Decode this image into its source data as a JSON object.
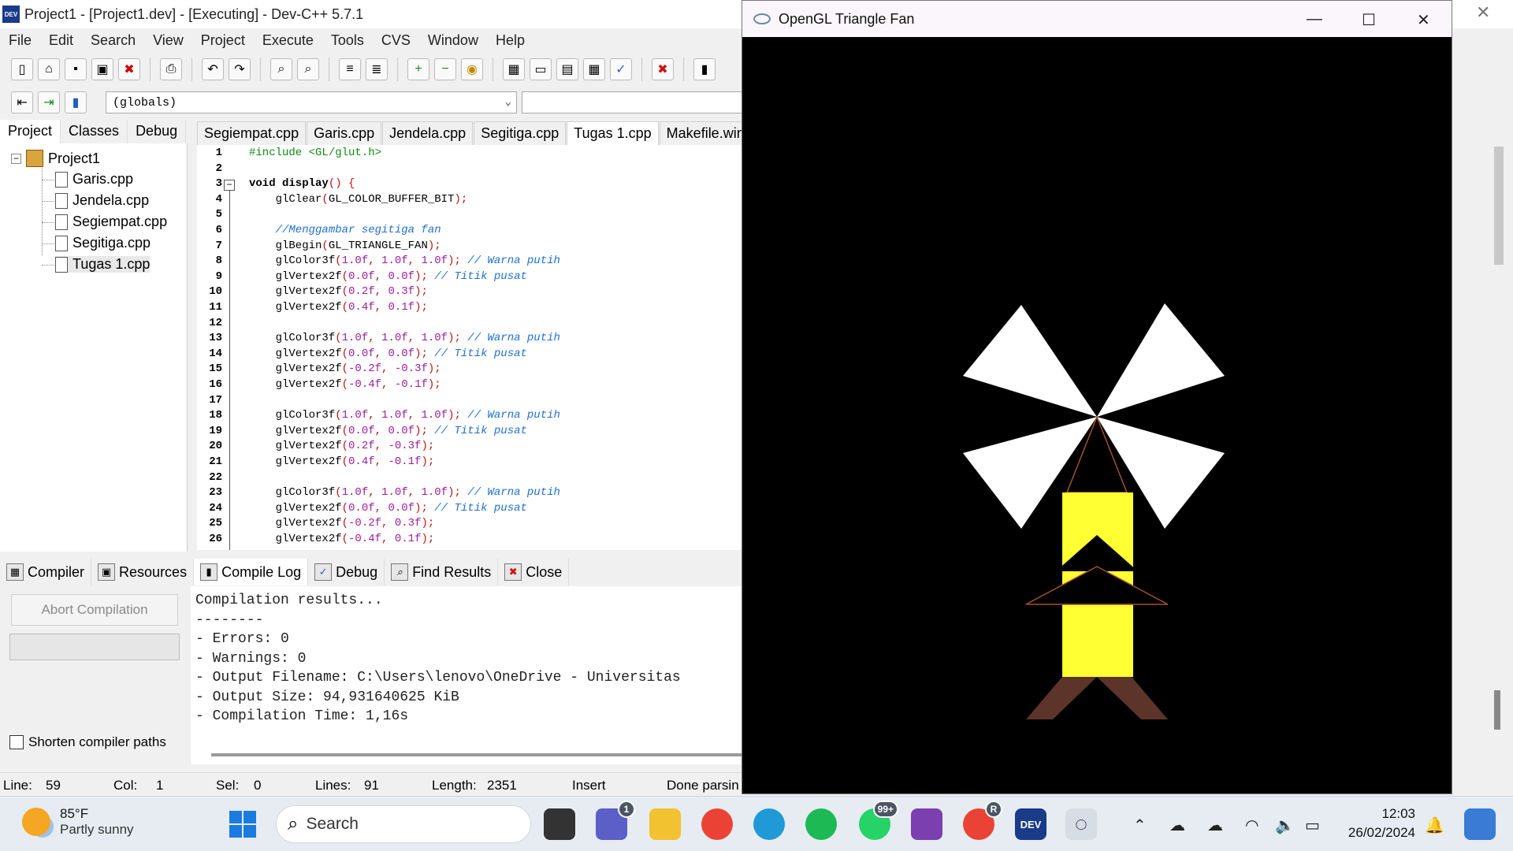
{
  "ide": {
    "title": "Project1 - [Project1.dev] - [Executing] - Dev-C++ 5.7.1",
    "app_icon_text": "DEV",
    "menu": [
      "File",
      "Edit",
      "Search",
      "View",
      "Project",
      "Execute",
      "Tools",
      "CVS",
      "Window",
      "Help"
    ],
    "scope_select": "(globals)",
    "left_tabs": [
      "Project",
      "Classes",
      "Debug"
    ],
    "tree": {
      "root": "Project1",
      "files": [
        "Garis.cpp",
        "Jendela.cpp",
        "Segiempat.cpp",
        "Segitiga.cpp",
        "Tugas 1.cpp"
      ]
    },
    "editor_tabs": [
      "Segiempat.cpp",
      "Garis.cpp",
      "Jendela.cpp",
      "Segitiga.cpp",
      "Tugas 1.cpp",
      "Makefile.win"
    ],
    "code_lines": [
      {
        "n": "1",
        "parts": [
          {
            "t": "#include <GL/glut.h>",
            "c": "pp"
          }
        ]
      },
      {
        "n": "2",
        "parts": []
      },
      {
        "n": "3",
        "parts": [
          {
            "t": "void display",
            "c": "kw"
          },
          {
            "t": "() {",
            "c": "pn"
          }
        ]
      },
      {
        "n": "4",
        "parts": [
          {
            "t": "    glClear",
            "c": ""
          },
          {
            "t": "(",
            "c": "pn"
          },
          {
            "t": "GL_COLOR_BUFFER_BIT",
            "c": ""
          },
          {
            "t": ");",
            "c": "pn"
          }
        ]
      },
      {
        "n": "5",
        "parts": []
      },
      {
        "n": "6",
        "parts": [
          {
            "t": "    //Menggambar segitiga fan",
            "c": "cm"
          }
        ]
      },
      {
        "n": "7",
        "parts": [
          {
            "t": "    glBegin",
            "c": ""
          },
          {
            "t": "(",
            "c": "pn"
          },
          {
            "t": "GL_TRIANGLE_FAN",
            "c": ""
          },
          {
            "t": ");",
            "c": "pn"
          }
        ]
      },
      {
        "n": "8",
        "parts": [
          {
            "t": "    glColor3f",
            "c": ""
          },
          {
            "t": "(",
            "c": "pn"
          },
          {
            "t": "1.0f",
            "c": "num"
          },
          {
            "t": ", ",
            "c": "pn"
          },
          {
            "t": "1.0f",
            "c": "num"
          },
          {
            "t": ", ",
            "c": "pn"
          },
          {
            "t": "1.0f",
            "c": "num"
          },
          {
            "t": "); ",
            "c": "pn"
          },
          {
            "t": "// Warna putih",
            "c": "cm"
          }
        ]
      },
      {
        "n": "9",
        "parts": [
          {
            "t": "    glVertex2f",
            "c": ""
          },
          {
            "t": "(",
            "c": "pn"
          },
          {
            "t": "0.0f",
            "c": "num"
          },
          {
            "t": ", ",
            "c": "pn"
          },
          {
            "t": "0.0f",
            "c": "num"
          },
          {
            "t": "); ",
            "c": "pn"
          },
          {
            "t": "// Titik pusat",
            "c": "cm"
          }
        ]
      },
      {
        "n": "10",
        "parts": [
          {
            "t": "    glVertex2f",
            "c": ""
          },
          {
            "t": "(",
            "c": "pn"
          },
          {
            "t": "0.2f",
            "c": "num"
          },
          {
            "t": ", ",
            "c": "pn"
          },
          {
            "t": "0.3f",
            "c": "num"
          },
          {
            "t": ");",
            "c": "pn"
          }
        ]
      },
      {
        "n": "11",
        "parts": [
          {
            "t": "    glVertex2f",
            "c": ""
          },
          {
            "t": "(",
            "c": "pn"
          },
          {
            "t": "0.4f",
            "c": "num"
          },
          {
            "t": ", ",
            "c": "pn"
          },
          {
            "t": "0.1f",
            "c": "num"
          },
          {
            "t": ");",
            "c": "pn"
          }
        ]
      },
      {
        "n": "12",
        "parts": []
      },
      {
        "n": "13",
        "parts": [
          {
            "t": "    glColor3f",
            "c": ""
          },
          {
            "t": "(",
            "c": "pn"
          },
          {
            "t": "1.0f",
            "c": "num"
          },
          {
            "t": ", ",
            "c": "pn"
          },
          {
            "t": "1.0f",
            "c": "num"
          },
          {
            "t": ", ",
            "c": "pn"
          },
          {
            "t": "1.0f",
            "c": "num"
          },
          {
            "t": "); ",
            "c": "pn"
          },
          {
            "t": "// Warna putih",
            "c": "cm"
          }
        ]
      },
      {
        "n": "14",
        "parts": [
          {
            "t": "    glVertex2f",
            "c": ""
          },
          {
            "t": "(",
            "c": "pn"
          },
          {
            "t": "0.0f",
            "c": "num"
          },
          {
            "t": ", ",
            "c": "pn"
          },
          {
            "t": "0.0f",
            "c": "num"
          },
          {
            "t": "); ",
            "c": "pn"
          },
          {
            "t": "// Titik pusat",
            "c": "cm"
          }
        ]
      },
      {
        "n": "15",
        "parts": [
          {
            "t": "    glVertex2f",
            "c": ""
          },
          {
            "t": "(",
            "c": "pn"
          },
          {
            "t": "-0.2f",
            "c": "num"
          },
          {
            "t": ", ",
            "c": "pn"
          },
          {
            "t": "-0.3f",
            "c": "num"
          },
          {
            "t": ");",
            "c": "pn"
          }
        ]
      },
      {
        "n": "16",
        "parts": [
          {
            "t": "    glVertex2f",
            "c": ""
          },
          {
            "t": "(",
            "c": "pn"
          },
          {
            "t": "-0.4f",
            "c": "num"
          },
          {
            "t": ", ",
            "c": "pn"
          },
          {
            "t": "-0.1f",
            "c": "num"
          },
          {
            "t": ");",
            "c": "pn"
          }
        ]
      },
      {
        "n": "17",
        "parts": []
      },
      {
        "n": "18",
        "parts": [
          {
            "t": "    glColor3f",
            "c": ""
          },
          {
            "t": "(",
            "c": "pn"
          },
          {
            "t": "1.0f",
            "c": "num"
          },
          {
            "t": ", ",
            "c": "pn"
          },
          {
            "t": "1.0f",
            "c": "num"
          },
          {
            "t": ", ",
            "c": "pn"
          },
          {
            "t": "1.0f",
            "c": "num"
          },
          {
            "t": "); ",
            "c": "pn"
          },
          {
            "t": "// Warna putih",
            "c": "cm"
          }
        ]
      },
      {
        "n": "19",
        "parts": [
          {
            "t": "    glVertex2f",
            "c": ""
          },
          {
            "t": "(",
            "c": "pn"
          },
          {
            "t": "0.0f",
            "c": "num"
          },
          {
            "t": ", ",
            "c": "pn"
          },
          {
            "t": "0.0f",
            "c": "num"
          },
          {
            "t": "); ",
            "c": "pn"
          },
          {
            "t": "// Titik pusat",
            "c": "cm"
          }
        ]
      },
      {
        "n": "20",
        "parts": [
          {
            "t": "    glVertex2f",
            "c": ""
          },
          {
            "t": "(",
            "c": "pn"
          },
          {
            "t": "0.2f",
            "c": "num"
          },
          {
            "t": ", ",
            "c": "pn"
          },
          {
            "t": "-0.3f",
            "c": "num"
          },
          {
            "t": ");",
            "c": "pn"
          }
        ]
      },
      {
        "n": "21",
        "parts": [
          {
            "t": "    glVertex2f",
            "c": ""
          },
          {
            "t": "(",
            "c": "pn"
          },
          {
            "t": "0.4f",
            "c": "num"
          },
          {
            "t": ", ",
            "c": "pn"
          },
          {
            "t": "-0.1f",
            "c": "num"
          },
          {
            "t": ");",
            "c": "pn"
          }
        ]
      },
      {
        "n": "22",
        "parts": []
      },
      {
        "n": "23",
        "parts": [
          {
            "t": "    glColor3f",
            "c": ""
          },
          {
            "t": "(",
            "c": "pn"
          },
          {
            "t": "1.0f",
            "c": "num"
          },
          {
            "t": ", ",
            "c": "pn"
          },
          {
            "t": "1.0f",
            "c": "num"
          },
          {
            "t": ", ",
            "c": "pn"
          },
          {
            "t": "1.0f",
            "c": "num"
          },
          {
            "t": "); ",
            "c": "pn"
          },
          {
            "t": "// Warna putih",
            "c": "cm"
          }
        ]
      },
      {
        "n": "24",
        "parts": [
          {
            "t": "    glVertex2f",
            "c": ""
          },
          {
            "t": "(",
            "c": "pn"
          },
          {
            "t": "0.0f",
            "c": "num"
          },
          {
            "t": ", ",
            "c": "pn"
          },
          {
            "t": "0.0f",
            "c": "num"
          },
          {
            "t": "); ",
            "c": "pn"
          },
          {
            "t": "// Titik pusat",
            "c": "cm"
          }
        ]
      },
      {
        "n": "25",
        "parts": [
          {
            "t": "    glVertex2f",
            "c": ""
          },
          {
            "t": "(",
            "c": "pn"
          },
          {
            "t": "-0.2f",
            "c": "num"
          },
          {
            "t": ", ",
            "c": "pn"
          },
          {
            "t": "0.3f",
            "c": "num"
          },
          {
            "t": ");",
            "c": "pn"
          }
        ]
      },
      {
        "n": "26",
        "parts": [
          {
            "t": "    glVertex2f",
            "c": ""
          },
          {
            "t": "(",
            "c": "pn"
          },
          {
            "t": "-0.4f",
            "c": "num"
          },
          {
            "t": ", ",
            "c": "pn"
          },
          {
            "t": "0.1f",
            "c": "num"
          },
          {
            "t": ");",
            "c": "pn"
          }
        ]
      }
    ],
    "bottom_tabs": [
      "Compiler",
      "Resources",
      "Compile Log",
      "Debug",
      "Find Results",
      "Close"
    ],
    "abort_button": "Abort Compilation",
    "shorten_paths_label": "Shorten compiler paths",
    "compile_log": [
      "Compilation results...",
      "--------",
      "- Errors: 0",
      "- Warnings: 0",
      "- Output Filename: C:\\Users\\lenovo\\OneDrive - Universitas",
      "- Output Size: 94,931640625 KiB",
      "- Compilation Time: 1,16s"
    ],
    "status": {
      "line_label": "Line:",
      "line": "59",
      "col_label": "Col:",
      "col": "1",
      "sel_label": "Sel:",
      "sel": "0",
      "lines_label": "Lines:",
      "lines": "91",
      "length_label": "Length:",
      "length": "2351",
      "mode": "Insert",
      "parse": "Done parsin"
    }
  },
  "gl_window": {
    "title": "OpenGL Triangle Fan",
    "scene_colors": {
      "background": "#000000",
      "blades": "#ffffff",
      "body": "#ffff33",
      "outline": "#a0522d",
      "feet": "#5c3429"
    }
  },
  "taskbar": {
    "weather_temp": "85°F",
    "weather_cond": "Partly sunny",
    "search_label": "Search",
    "teams_badge": "1",
    "whatsapp_badge": "99+",
    "chrome_profile": "R",
    "devcpp_label": "DEV",
    "clock_time": "12:03",
    "clock_date": "26/02/2024"
  }
}
